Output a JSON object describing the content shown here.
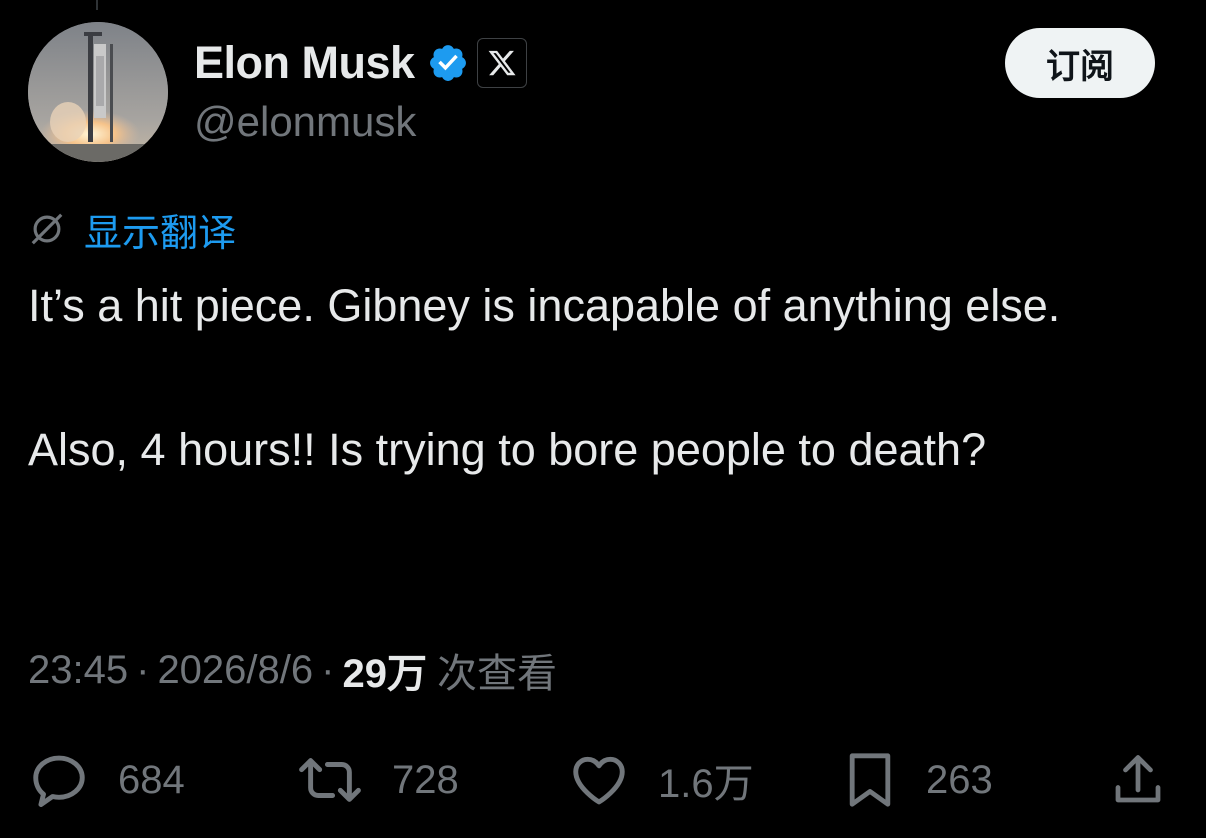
{
  "header": {
    "display_name": "Elon Musk",
    "handle": "@elonmusk",
    "subscribe_label": "订阅"
  },
  "translate": {
    "label": "显示翻译"
  },
  "tweet": {
    "paragraphs": [
      "It’s a hit piece. Gibney is incapable of anything else.",
      "Also, 4 hours!! Is trying to bore people to death?"
    ]
  },
  "meta": {
    "time": "23:45",
    "separator": "·",
    "date": "2026/8/6",
    "views_count": "29万",
    "views_label": "次查看"
  },
  "actions": {
    "replies": "684",
    "retweets": "728",
    "likes": "1.6万",
    "bookmarks": "263"
  },
  "colors": {
    "background": "#000000",
    "text_primary": "#e7e9ea",
    "text_secondary": "#71767b",
    "link_blue": "#1d9bf0",
    "verified_blue": "#1d9bf0",
    "button_bg": "#eff3f4"
  },
  "icons": {
    "verified": "verified-badge-icon",
    "affiliate": "x-logo-icon",
    "translate": "globe-slash-icon",
    "reply": "reply-icon",
    "retweet": "retweet-icon",
    "like": "heart-icon",
    "bookmark": "bookmark-icon",
    "share": "share-icon"
  }
}
